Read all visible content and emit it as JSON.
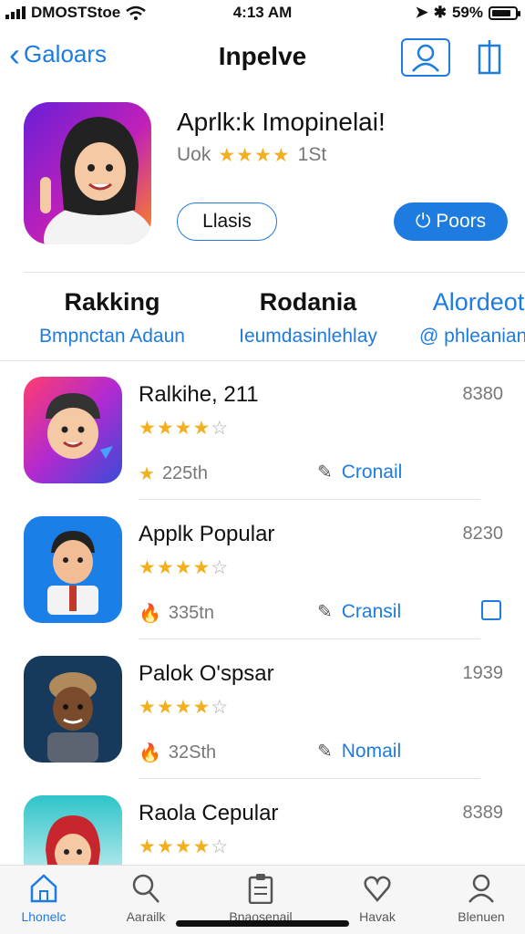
{
  "status": {
    "carrier": "DMOSTStoe",
    "time": "4:13 AM",
    "battery": "59%"
  },
  "nav": {
    "back_label": "Galoars",
    "title": "Inpelve"
  },
  "hero": {
    "title": "Aprlk:k Imopinelai!",
    "rating_text": "Uok",
    "stars": "★★★★",
    "rating_count": "1St",
    "button_outline": "Llasis",
    "button_fill": "Poors"
  },
  "categories": [
    {
      "title": "Rakking",
      "subtitle": "Bmpnctan Adaun"
    },
    {
      "title": "Rodania",
      "subtitle": "Ieumdasinlehlay"
    },
    {
      "title": "Alordeot",
      "subtitle": "@ phleanianu"
    }
  ],
  "apps": [
    {
      "name": "Ralkihe, 211",
      "price": "8380",
      "stars": "★★★★",
      "empty_star": "☆",
      "meta_icon": "★",
      "meta": "225th",
      "action": "Cronail",
      "rating": 4
    },
    {
      "name": "Applk Popular",
      "price": "8230",
      "stars": "★★★★",
      "empty_star": "☆",
      "meta_icon": "🔥",
      "meta": "335tn",
      "action": "Cransil",
      "rating": 4
    },
    {
      "name": "Palok O'spsar",
      "price": "1939",
      "stars": "★★★★",
      "empty_star": "☆",
      "meta_icon": "🔥",
      "meta": "32Sth",
      "action": "Nomail",
      "rating": 4
    },
    {
      "name": "Raola Cepular",
      "price": "8389",
      "stars": "★★★★",
      "empty_star": "☆",
      "meta_icon": "",
      "meta": "",
      "action": "",
      "rating": 4
    }
  ],
  "tabs": [
    {
      "label": "Lhonelc",
      "icon": "home-icon"
    },
    {
      "label": "Aarailk",
      "icon": "search-icon"
    },
    {
      "label": "Bnaosenail",
      "icon": "clipboard-icon"
    },
    {
      "label": "Havak",
      "icon": "heart-icon"
    },
    {
      "label": "Blenuen",
      "icon": "profile-icon"
    }
  ],
  "colors": {
    "accent": "#1e7be0",
    "star": "#f2b021"
  }
}
